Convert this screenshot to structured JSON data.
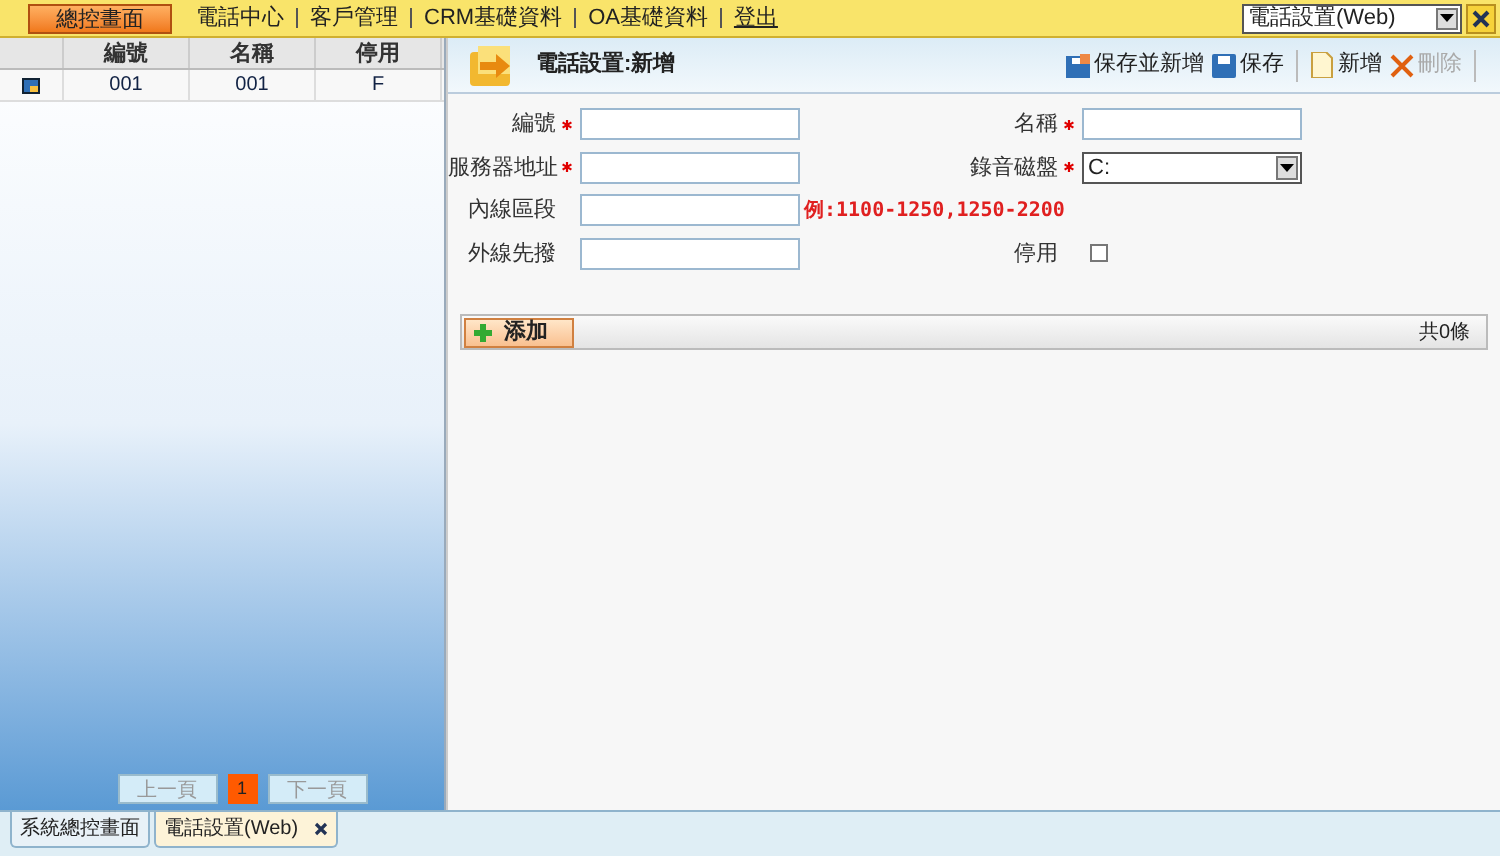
{
  "top_menu": [
    {
      "label": "總控畫面",
      "selected": true
    },
    {
      "label": "電話中心",
      "selected": false
    },
    {
      "label": "客戶管理",
      "selected": false
    },
    {
      "label": "CRM基礎資料",
      "selected": false
    },
    {
      "label": "OA基礎資料",
      "selected": false
    },
    {
      "label": "登出",
      "selected": false,
      "kind": "link"
    }
  ],
  "window_select": {
    "value": "電話設置(Web)"
  },
  "grid": {
    "columns": [
      "編號",
      "名稱",
      "停用"
    ],
    "rows": [
      {
        "cells": [
          "001",
          "001",
          "F"
        ],
        "selected": false
      }
    ]
  },
  "pager": {
    "prev": "上一頁",
    "page": "1",
    "next": "下一頁"
  },
  "panel": {
    "title": "電話設置:新增",
    "toolbar": [
      {
        "label": "保存並新增",
        "kind": "save-new",
        "disabled": false
      },
      {
        "label": "保存",
        "kind": "save",
        "disabled": false
      },
      {
        "label": "新增",
        "kind": "new",
        "disabled": false
      },
      {
        "label": "刪除",
        "kind": "delete",
        "disabled": true
      }
    ]
  },
  "form": [
    {
      "label": "編號",
      "required": true,
      "kind": "text"
    },
    {
      "label": "名稱",
      "required": true,
      "kind": "text"
    },
    {
      "label": "服務器地址",
      "required": true,
      "kind": "text"
    },
    {
      "label": "錄音磁盤",
      "required": true,
      "kind": "select",
      "value": "C:"
    },
    {
      "label": "內線區段",
      "required": false,
      "kind": "text",
      "hint": "例:1100-1250,1250-2200"
    },
    {
      "kind": "empty"
    },
    {
      "label": "外線先撥",
      "required": false,
      "kind": "text"
    },
    {
      "label": "停用",
      "required": false,
      "kind": "checkbox",
      "checked": false
    }
  ],
  "detail": {
    "add_button": "添加",
    "count": "共0條"
  },
  "bottom_tabs": [
    {
      "label": "系統總控畫面",
      "selected": false,
      "closable": false
    },
    {
      "label": "電話設置(Web)",
      "selected": true,
      "closable": true
    }
  ]
}
